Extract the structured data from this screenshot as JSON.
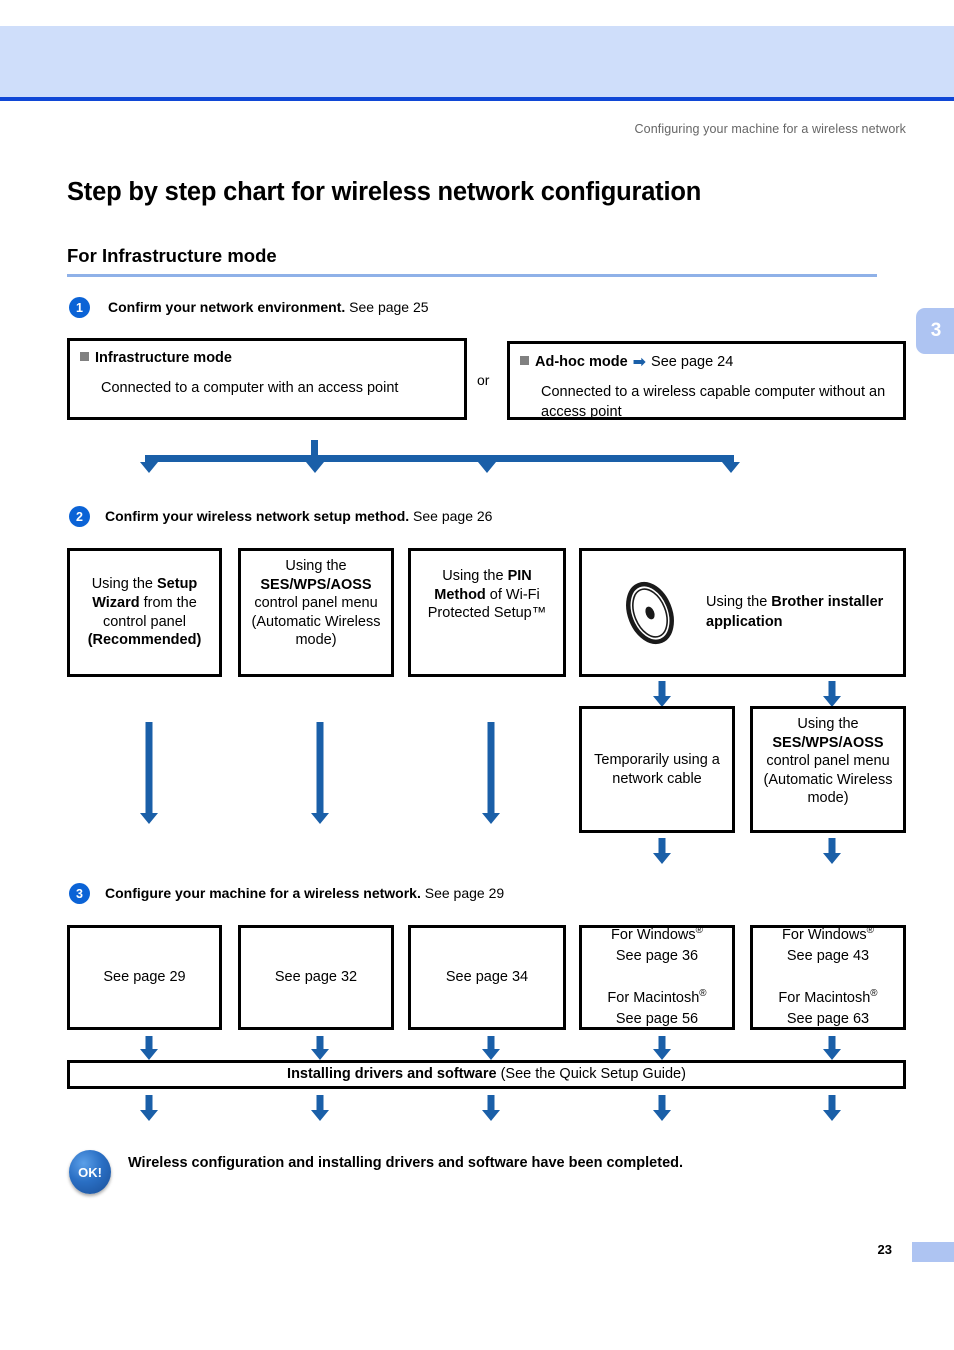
{
  "header": {
    "caption": "Configuring your machine for a wireless network",
    "chapter_tab": "3"
  },
  "titles": {
    "h1": "Step by step chart for wireless network configuration",
    "h2": "For Infrastructure mode"
  },
  "steps": [
    {
      "num": "1",
      "bold": "Confirm your network environment.",
      "rest": " See page 25"
    },
    {
      "num": "2",
      "bold": "Confirm your wireless network setup method.",
      "rest": " See page 26"
    },
    {
      "num": "3",
      "bold": "Configure your machine for a wireless network.",
      "rest": " See page 29"
    }
  ],
  "row1": {
    "infrastructure": {
      "title": "Infrastructure mode",
      "body": "Connected to a computer with an access point"
    },
    "or_label": "or",
    "adhoc": {
      "title": "Ad-hoc mode",
      "arrow_glyph": "➡",
      "link": "See page 24",
      "body": "Connected to a wireless capable computer without an access point"
    }
  },
  "row2_methods": [
    {
      "lines": [
        {
          "text": "Using the ",
          "bold": false
        },
        {
          "text": "Setup Wizard",
          "bold": true
        },
        {
          "text": " from the control panel ",
          "bold": false
        },
        {
          "text": "(Recommended)",
          "bold": true
        }
      ],
      "plain": "Using the Setup Wizard from the control panel (Recommended)"
    },
    {
      "lines": [
        {
          "text": "Using the ",
          "bold": false
        },
        {
          "text": "SES/WPS/AOSS",
          "bold": true
        },
        {
          "text": " control panel menu (Automatic Wireless mode)",
          "bold": false
        }
      ],
      "plain": "Using the SES/WPS/AOSS control panel menu (Automatic Wireless mode)"
    },
    {
      "lines": [
        {
          "text": "Using the ",
          "bold": false
        },
        {
          "text": "PIN Method",
          "bold": true
        },
        {
          "text": " of Wi-Fi Protected Setup™",
          "bold": false
        }
      ],
      "plain": "Using the PIN Method of Wi-Fi Protected Setup™"
    },
    {
      "lines": [
        {
          "text": "Using the ",
          "bold": false
        },
        {
          "text": "Brother installer application",
          "bold": true
        }
      ],
      "plain": "Using the Brother installer application",
      "icon": "cd-disc-icon"
    }
  ],
  "row2_sub": {
    "cable": "Temporarily using a network cable",
    "ses": {
      "pre": "Using the ",
      "bold": "SES/WPS/AOSS",
      "post": " control panel menu (Automatic Wireless mode)",
      "plain": "Using the SES/WPS/AOSS control panel menu (Automatic Wireless mode)"
    }
  },
  "row3_pages": [
    {
      "plain": "See page 29"
    },
    {
      "plain": "See page 32"
    },
    {
      "plain": "See page 34"
    },
    {
      "windows_label": "For Windows",
      "windows_page": "See page 36",
      "mac_label": "For Macintosh",
      "mac_page": "See page 56"
    },
    {
      "windows_label": "For Windows",
      "windows_page": "See page 43",
      "mac_label": "For Macintosh",
      "mac_page": "See page 63"
    }
  ],
  "install_bar": {
    "bold": "Installing drivers and software",
    "rest": " (See the Quick Setup Guide)"
  },
  "completion": {
    "badge": "OK!",
    "text": "Wireless configuration and installing drivers and software have been completed."
  },
  "footer": {
    "page_number": "23"
  },
  "colors": {
    "arrow_blue": "#1a5fa8",
    "header_band": "#cfdefa",
    "header_rule": "#1047d6",
    "step_circle": "#0b63d6",
    "rule_light": "#8fb1e8"
  }
}
